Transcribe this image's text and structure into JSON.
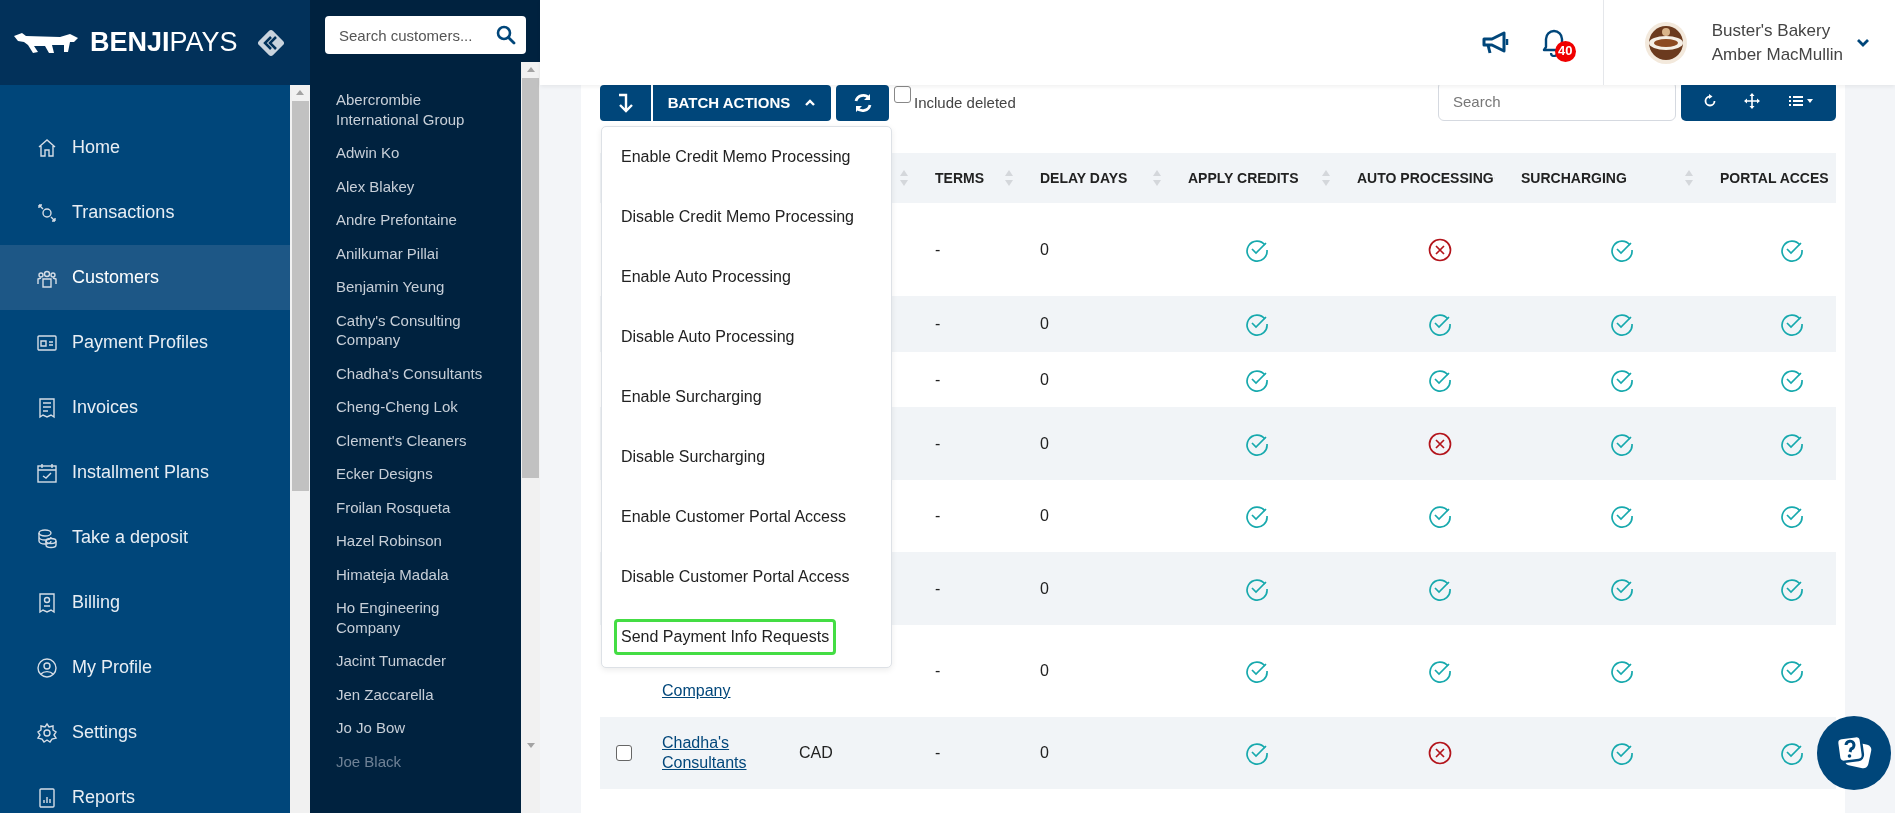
{
  "logo": {
    "bold": "BENJI",
    "light": "PAYS"
  },
  "nav": [
    {
      "label": "Home",
      "selected": false
    },
    {
      "label": "Transactions",
      "selected": false
    },
    {
      "label": "Customers",
      "selected": true
    },
    {
      "label": "Payment Profiles",
      "selected": false
    },
    {
      "label": "Invoices",
      "selected": false
    },
    {
      "label": "Installment Plans",
      "selected": false
    },
    {
      "label": "Take a deposit",
      "selected": false
    },
    {
      "label": "Billing",
      "selected": false
    },
    {
      "label": "My Profile",
      "selected": false
    },
    {
      "label": "Settings",
      "selected": false
    },
    {
      "label": "Reports",
      "selected": false
    }
  ],
  "customer_panel": {
    "search": {
      "placeholder": "Search customers..."
    },
    "customers": [
      "Abercrombie International Group",
      "Adwin Ko",
      "Alex Blakey",
      "Andre Prefontaine",
      "Anilkumar Pillai",
      "Benjamin Yeung",
      "Cathy's Consulting Company",
      "Chadha's Consultants",
      "Cheng-Cheng Lok",
      "Clement's Cleaners",
      "Ecker Designs",
      "Froilan Rosqueta",
      "Hazel Robinson",
      "Himateja Madala",
      "Ho Engineering Company",
      "Jacint Tumacder",
      "Jen Zaccarella",
      "Jo Jo Bow",
      "Joe Black"
    ]
  },
  "header": {
    "notifications_badge": "40",
    "account": {
      "business": "Buster's Bakery",
      "user": "Amber MacMullin"
    }
  },
  "toolbar": {
    "batch_actions": {
      "label": "BATCH ACTIONS",
      "expanded": true,
      "menu": [
        {
          "label": "Enable Credit Memo Processing",
          "selected": false
        },
        {
          "label": "Disable Credit Memo Processing",
          "selected": false
        },
        {
          "label": "Enable Auto Processing",
          "selected": false
        },
        {
          "label": "Disable Auto Processing",
          "selected": false
        },
        {
          "label": "Enable Surcharging",
          "selected": false
        },
        {
          "label": "Disable Surcharging",
          "selected": false
        },
        {
          "label": "Enable Customer Portal Access",
          "selected": false
        },
        {
          "label": "Disable Customer Portal Access",
          "selected": false
        },
        {
          "label": "Send Payment Info Requests",
          "selected": true
        }
      ]
    },
    "include_deleted": {
      "label": "Include deleted",
      "checked": false
    },
    "search": {
      "placeholder": "Search"
    }
  },
  "table": {
    "columns": [
      "TERMS",
      "DELAY DAYS",
      "APPLY CREDITS",
      "AUTO PROCESSING",
      "SURCHARGING",
      "PORTAL ACCES"
    ],
    "rows": [
      {
        "terms": "-",
        "delay_days": "0",
        "apply_credits": true,
        "auto_processing": false,
        "surcharging": true,
        "portal_access": true
      },
      {
        "terms": "-",
        "delay_days": "0",
        "apply_credits": true,
        "auto_processing": true,
        "surcharging": true,
        "portal_access": true
      },
      {
        "terms": "-",
        "delay_days": "0",
        "apply_credits": true,
        "auto_processing": true,
        "surcharging": true,
        "portal_access": true
      },
      {
        "terms": "-",
        "delay_days": "0",
        "apply_credits": true,
        "auto_processing": false,
        "surcharging": true,
        "portal_access": true
      },
      {
        "terms": "-",
        "delay_days": "0",
        "apply_credits": true,
        "auto_processing": true,
        "surcharging": true,
        "portal_access": true
      },
      {
        "terms": "-",
        "delay_days": "0",
        "apply_credits": true,
        "auto_processing": true,
        "surcharging": true,
        "portal_access": true
      },
      {
        "name": "Company",
        "terms": "-",
        "delay_days": "0",
        "apply_credits": true,
        "auto_processing": true,
        "surcharging": true,
        "portal_access": true
      },
      {
        "checked": false,
        "name": "Chadha's Consultants",
        "currency": "CAD",
        "terms": "-",
        "delay_days": "0",
        "apply_credits": true,
        "auto_processing": false,
        "surcharging": true,
        "portal_access": true
      }
    ]
  }
}
